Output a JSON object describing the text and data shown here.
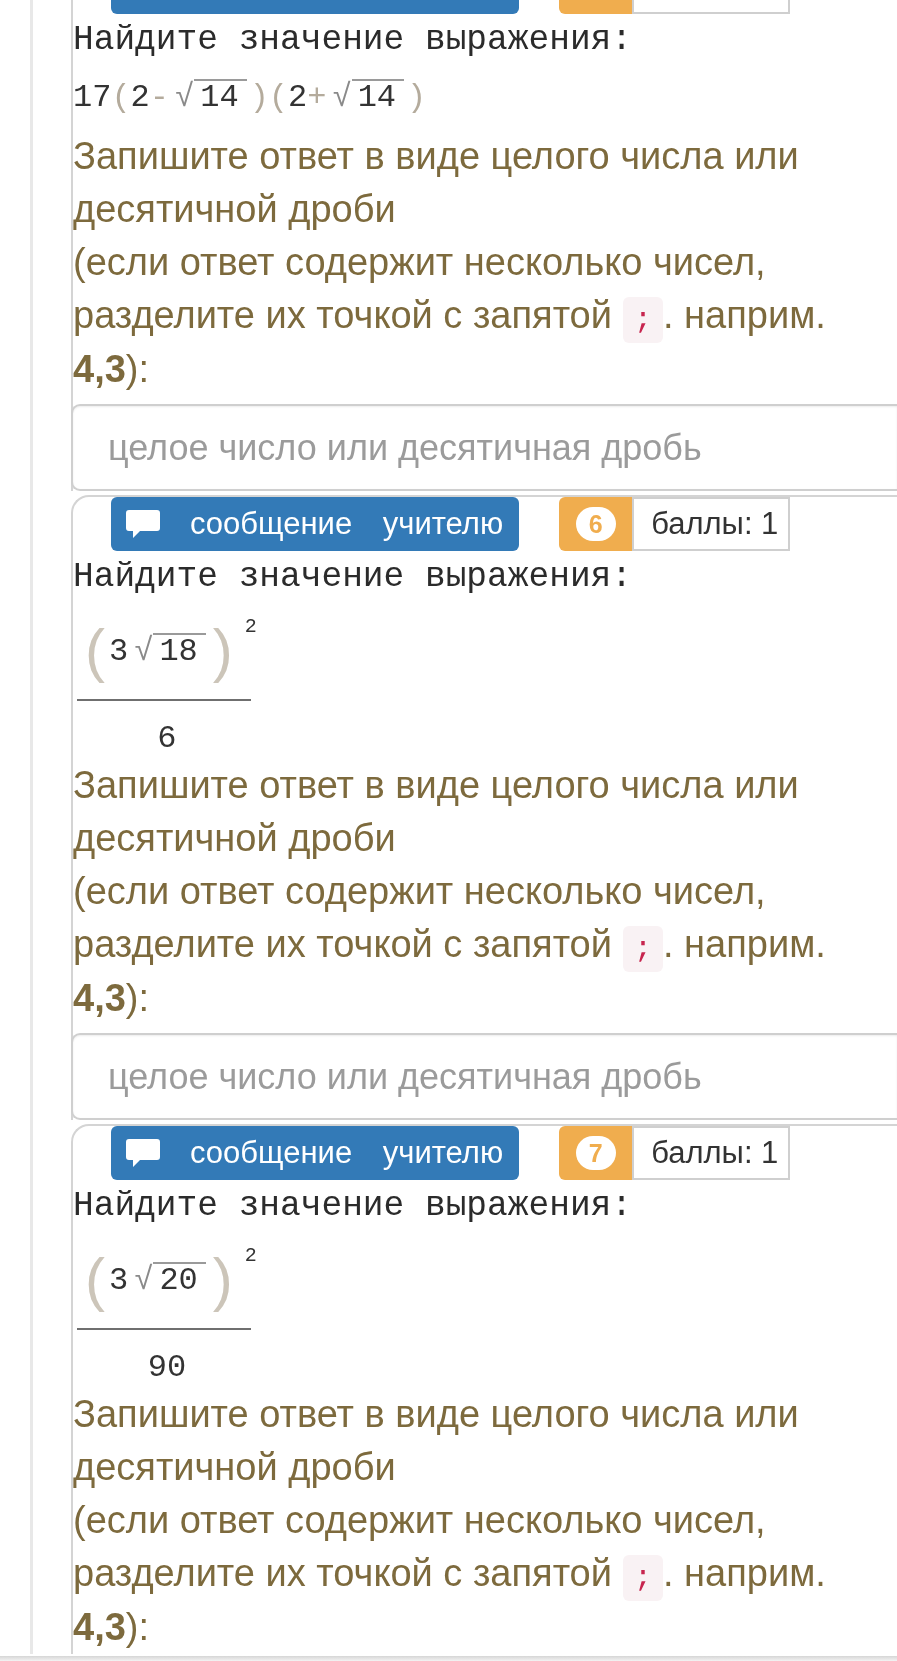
{
  "questions": [
    {
      "header_cut_off": true,
      "heading": "Найдите значение выражения:",
      "formula": {
        "kind": "inline",
        "tokens": [
          {
            "kind": "num",
            "text": "17"
          },
          {
            "kind": "op",
            "text": "("
          },
          {
            "kind": "num",
            "text": "2"
          },
          {
            "kind": "op",
            "text": "-"
          },
          {
            "kind": "root",
            "sign": "√",
            "radicand": "14"
          },
          {
            "kind": "op",
            "text": ")"
          },
          {
            "kind": "op",
            "text": "("
          },
          {
            "kind": "num",
            "text": "2"
          },
          {
            "kind": "op",
            "text": "+"
          },
          {
            "kind": "root",
            "sign": "√",
            "radicand": "14"
          },
          {
            "kind": "op",
            "text": ")"
          }
        ]
      },
      "instruction": "Запишите ответ в виде целого числа или десятичной дроби",
      "hint_before": "(если ответ содержит несколько чисел, разделите их точкой с запятой",
      "separator_code": ";",
      "hint_after": ". наприм. **4,3**):",
      "answer_field": {
        "placeholder": "целое число или десятичная дробь"
      }
    },
    {
      "header_cut_off": false,
      "header": {
        "message_button": "сообщение учителю",
        "number": "6",
        "score": "баллы: 1"
      },
      "heading": "Найдите значение выражения:",
      "formula": {
        "kind": "fraction",
        "numerator": [
          {
            "kind": "paren",
            "text": "("
          },
          {
            "kind": "num",
            "text": "3"
          },
          {
            "kind": "root",
            "sign": "√",
            "radicand": "18"
          },
          {
            "kind": "paren",
            "text": ")"
          }
        ],
        "exponent": "2",
        "denominator": "6"
      },
      "instruction": "Запишите ответ в виде целого числа или десятичной дроби",
      "hint_before": "(если ответ содержит несколько чисел, разделите их точкой с запятой",
      "separator_code": ";",
      "hint_after": ". наприм. **4,3**):",
      "answer_field": {
        "placeholder": "целое число или десятичная дробь"
      }
    },
    {
      "header_cut_off": false,
      "header": {
        "message_button": "сообщение учителю",
        "number": "7",
        "score": "баллы: 1"
      },
      "heading": "Найдите значение выражения:",
      "formula": {
        "kind": "fraction",
        "numerator": [
          {
            "kind": "paren",
            "text": "("
          },
          {
            "kind": "num",
            "text": "3"
          },
          {
            "kind": "root",
            "sign": "√",
            "radicand": "20"
          },
          {
            "kind": "paren",
            "text": ")"
          }
        ],
        "exponent": "2",
        "denominator": "90"
      },
      "instruction": "Запишите ответ в виде целого числа или десятичной дроби",
      "hint_before": "(если ответ содержит несколько чисел, разделите их точкой с запятой",
      "separator_code": ";",
      "hint_after": ". наприм. **4,3**):"
    }
  ]
}
